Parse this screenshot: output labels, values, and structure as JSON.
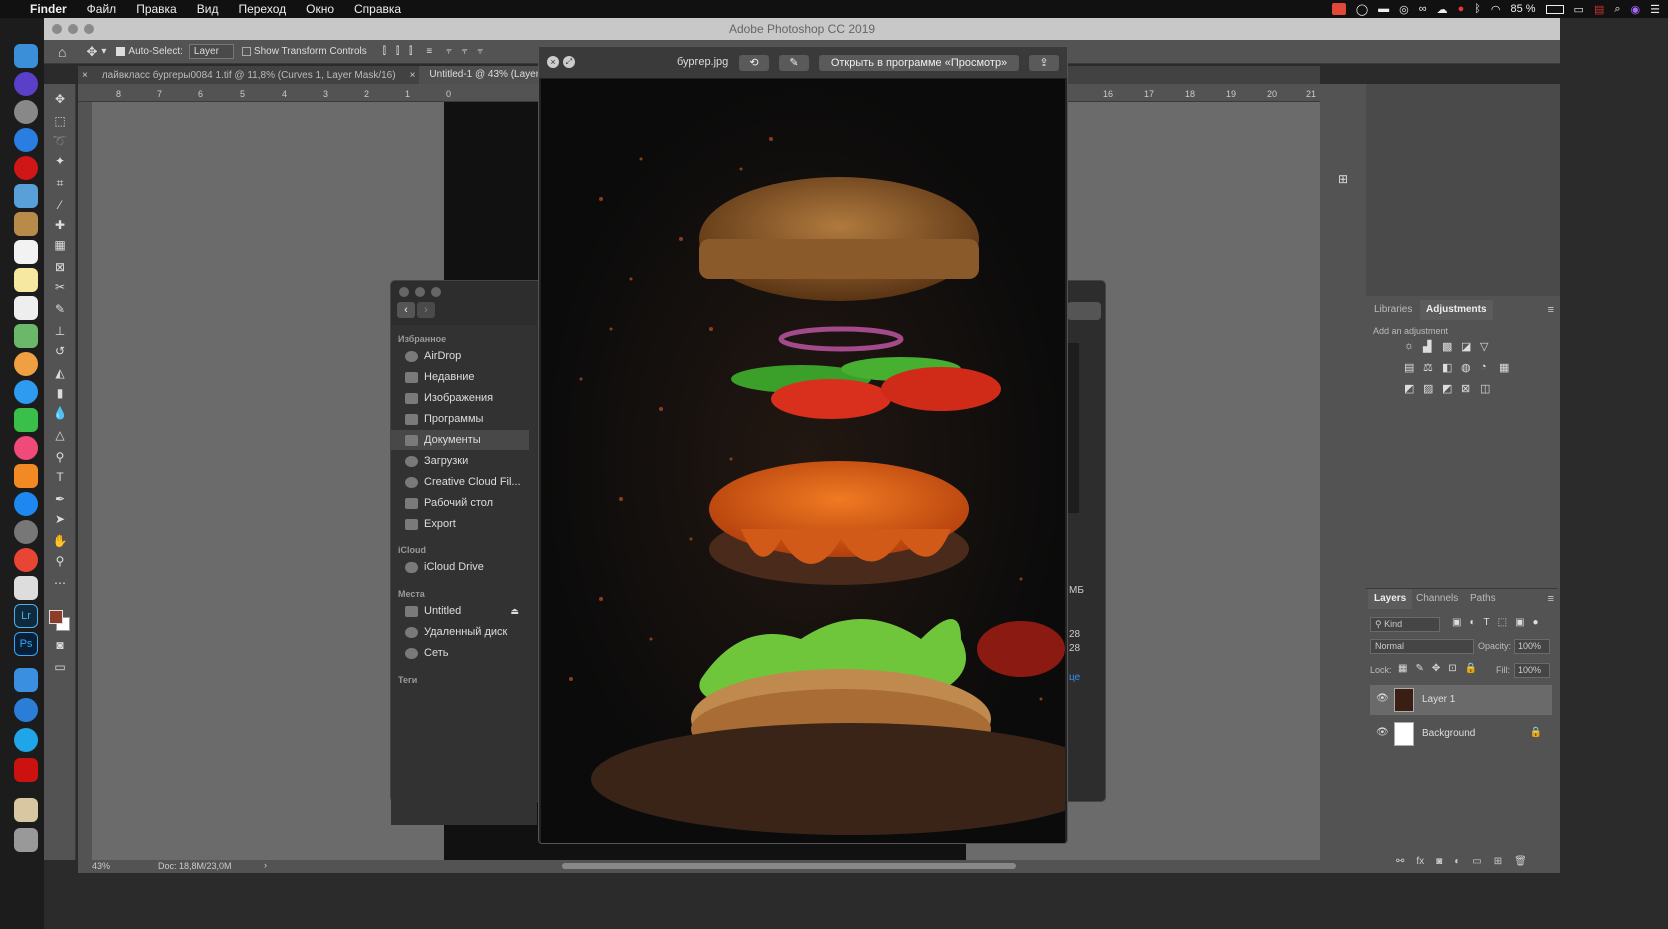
{
  "menubar": {
    "apple": "",
    "app": "Finder",
    "items": [
      "Файл",
      "Правка",
      "Вид",
      "Переход",
      "Окно",
      "Справка"
    ],
    "battery": "85 %"
  },
  "photoshop": {
    "title": "Adobe Photoshop CC 2019",
    "options": {
      "auto_select_label": "Auto-Select:",
      "auto_select_value": "Layer",
      "show_transform_label": "Show Transform Controls"
    },
    "tabs": [
      {
        "label": "лайвкласс бургеры0084 1.tif @ 11,8% (Curves 1, Layer Mask/16)"
      },
      {
        "label": "Untitled-1 @ 43% (Layer"
      }
    ],
    "ruler_top": [
      "8",
      "7",
      "6",
      "5",
      "4",
      "3",
      "2",
      "1",
      "0",
      "16",
      "17",
      "18",
      "19",
      "20",
      "21"
    ],
    "status": {
      "zoom": "43%",
      "doc": "Doc: 18,8M/23,0M"
    },
    "adjustments": {
      "tabs": [
        "Libraries",
        "Adjustments"
      ],
      "hint": "Add an adjustment"
    },
    "layers": {
      "tabs": [
        "Layers",
        "Channels",
        "Paths"
      ],
      "filter": "Kind",
      "blend": "Normal",
      "opacity_label": "Opacity:",
      "opacity": "100%",
      "lock_label": "Lock:",
      "fill_label": "Fill:",
      "fill": "100%",
      "items": [
        {
          "name": "Layer 1"
        },
        {
          "name": "Background"
        }
      ]
    }
  },
  "finder": {
    "favorites_header": "Избранное",
    "favorites": [
      "AirDrop",
      "Недавние",
      "Изображения",
      "Программы",
      "Документы",
      "Загрузки",
      "Creative Cloud Fil...",
      "Рабочий стол",
      "Export"
    ],
    "icloud_header": "iCloud",
    "icloud": [
      "iCloud Drive"
    ],
    "places_header": "Места",
    "places": [
      "Untitled",
      "Удаленный диск",
      "Сеть"
    ],
    "tags_header": "Теги",
    "partial_right": [
      "МБ",
      "28",
      "28",
      "це"
    ]
  },
  "quicklook": {
    "filename": "бургер.jpg",
    "open_button": "Открыть в программе «Просмотр»"
  }
}
